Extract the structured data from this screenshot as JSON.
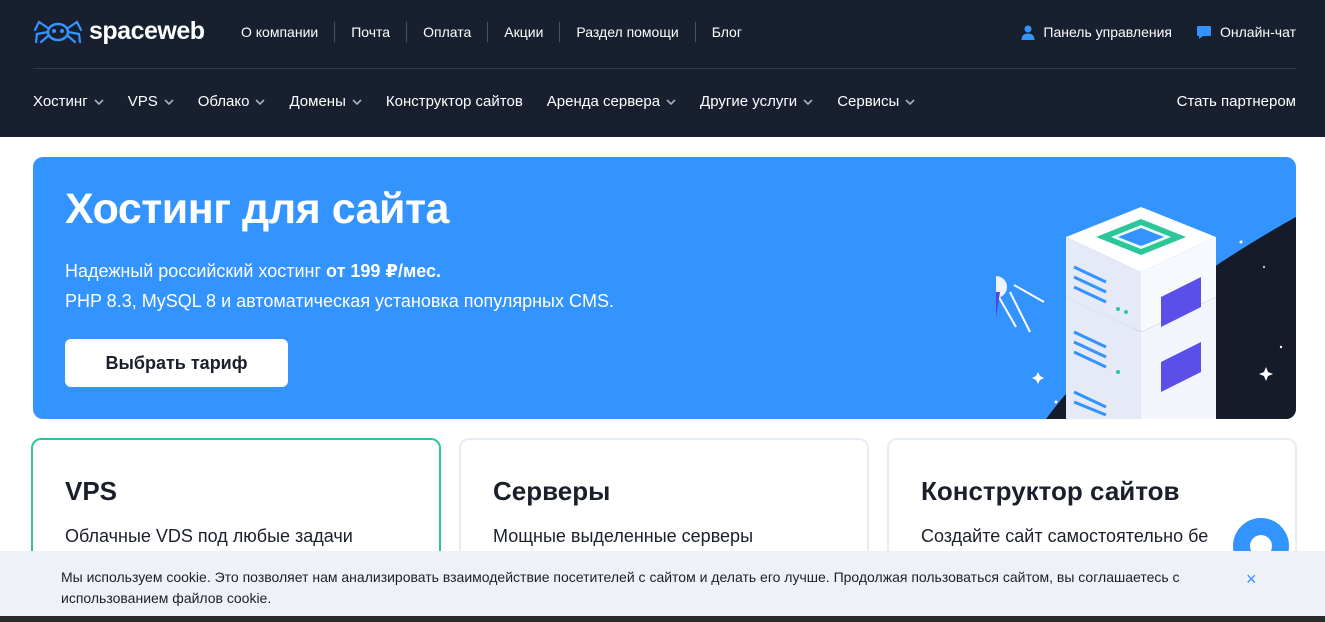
{
  "brand": {
    "name": "spaceweb"
  },
  "topnav": {
    "links": [
      "О компании",
      "Почта",
      "Оплата",
      "Акции",
      "Раздел помощи",
      "Блог"
    ],
    "panel_label": "Панель управления",
    "chat_label": "Онлайн-чат"
  },
  "mainnav": {
    "items": [
      "Хостинг",
      "VPS",
      "Облако",
      "Домены",
      "Конструктор сайтов",
      "Аренда сервера",
      "Другие услуги",
      "Сервисы"
    ],
    "partner_label": "Стать партнером"
  },
  "hero": {
    "title": "Хостинг для сайта",
    "subtitle_prefix": "Надежный российский хостинг ",
    "subtitle_price": "от 199 ₽/мес.",
    "subtitle_line2": "PHP 8.3, MySQL 8 и автоматическая установка популярных CMS.",
    "button_label": "Выбрать тариф"
  },
  "cards": [
    {
      "title": "VPS",
      "desc": "Облачные VDS под любые задачи"
    },
    {
      "title": "Серверы",
      "desc": "Мощные выделенные серверы"
    },
    {
      "title": "Конструктор сайтов",
      "desc": "Создайте сайт самостоятельно бе"
    }
  ],
  "cookie": {
    "text": "Мы используем cookie. Это позволяет нам анализировать взаимодействие посетителей с сайтом и делать его лучше. Продолжая пользоваться сайтом, вы соглашаетесь с использованием файлов cookie.",
    "close_label": "×"
  },
  "colors": {
    "header_bg": "#182030",
    "accent": "#3393ff",
    "active_border": "#2cc69a",
    "cookie_bg": "#eef2f6"
  },
  "icons": {
    "logo": "spider-logo-icon",
    "panel": "user-icon",
    "chat": "chat-icon",
    "dropdown": "chevron-down-icon"
  }
}
